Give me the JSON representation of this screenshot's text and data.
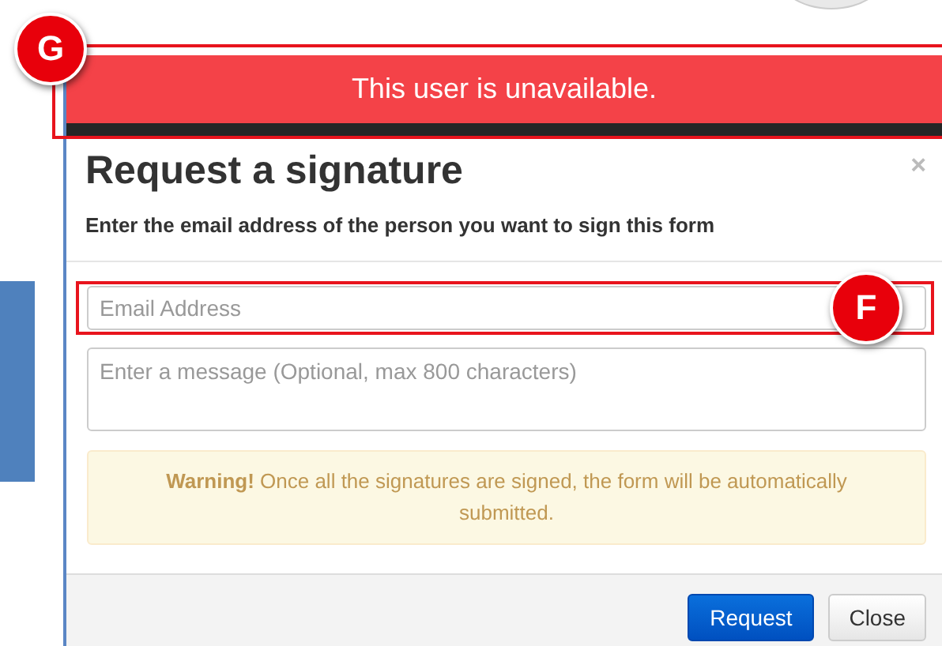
{
  "callouts": [
    {
      "letter": "G"
    },
    {
      "letter": "F"
    }
  ],
  "banner": {
    "text": "This user is unavailable."
  },
  "modal": {
    "title": "Request a signature",
    "close_icon": "×",
    "subtitle": "Enter the email address of the person you want to sign this form",
    "email": {
      "placeholder": "Email Address"
    },
    "message": {
      "placeholder": "Enter a message (Optional, max 800 characters)"
    },
    "warning": "**Warning!** Once all the signatures are signed, the form will be automatically submitted.",
    "buttons": [
      {
        "label": "Request",
        "kind": "primary"
      },
      {
        "label": "Close",
        "kind": "default"
      }
    ]
  }
}
